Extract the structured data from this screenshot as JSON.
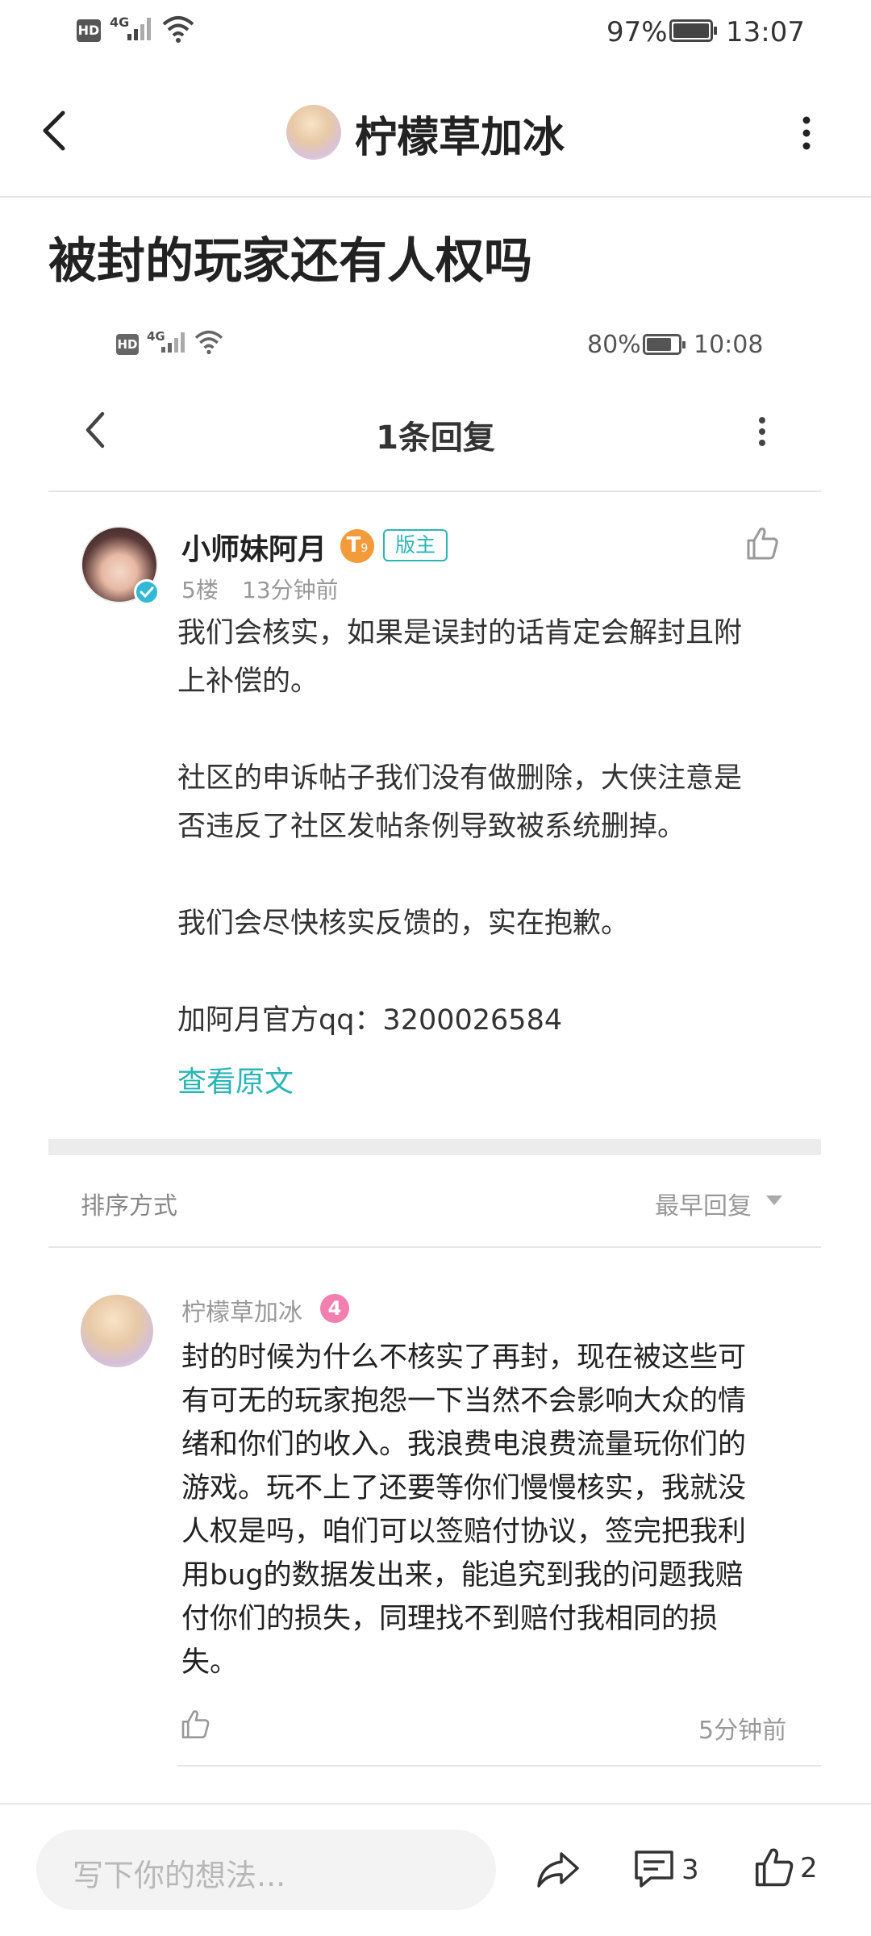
{
  "status_bar": {
    "hd": "HD",
    "network": "4G",
    "battery": "97%",
    "time": "13:07"
  },
  "header": {
    "title": "柠檬草加冰"
  },
  "post": {
    "title": "被封的玩家还有人权吗"
  },
  "embedded": {
    "status_bar": {
      "hd": "HD",
      "network": "4G",
      "battery": "80%",
      "time": "10:08"
    },
    "title": "1条回复",
    "reply": {
      "username": "小师妹阿月",
      "level_badge": "T",
      "level_sub": "9",
      "role_badge": "版主",
      "floor": "5楼",
      "time": "13分钟前",
      "paragraphs": [
        [
          "我们会核实，如果是误封的话肯定会解封且附",
          "上补偿的。"
        ],
        [
          "社区的申诉帖子我们没有做删除，大侠注意是",
          "否违反了社区发帖条例导致被系统删掉。"
        ],
        [
          "我们会尽快核实反馈的，实在抱歉。"
        ],
        [
          "加阿月官方qq：3200026584"
        ]
      ],
      "view_original": "查看原文"
    },
    "sort": {
      "label": "排序方式",
      "value": "最早回复"
    },
    "comment": {
      "username": "柠檬草加冰",
      "level": "4",
      "lines": [
        "封的时候为什么不核实了再封，现在被这些可",
        "有可无的玩家抱怨一下当然不会影响大众的情",
        "绪和你们的收入。我浪费电浪费流量玩你们的",
        "游戏。玩不上了还要等你们慢慢核实，我就没",
        "人权是吗，咱们可以签赔付协议，签完把我利",
        "用bug的数据发出来，能追究到我的问题我赔",
        "付你们的损失，同理找不到赔付我相同的损",
        "失。"
      ],
      "time": "5分钟前"
    }
  },
  "bottom_bar": {
    "placeholder": "写下你的想法...",
    "comment_count": "3",
    "like_count": "2"
  },
  "colors": {
    "accent": "#2bb5b5",
    "badge_orange": "#f39a3b",
    "badge_pink": "#f27fb0",
    "verified": "#33b8d6"
  }
}
